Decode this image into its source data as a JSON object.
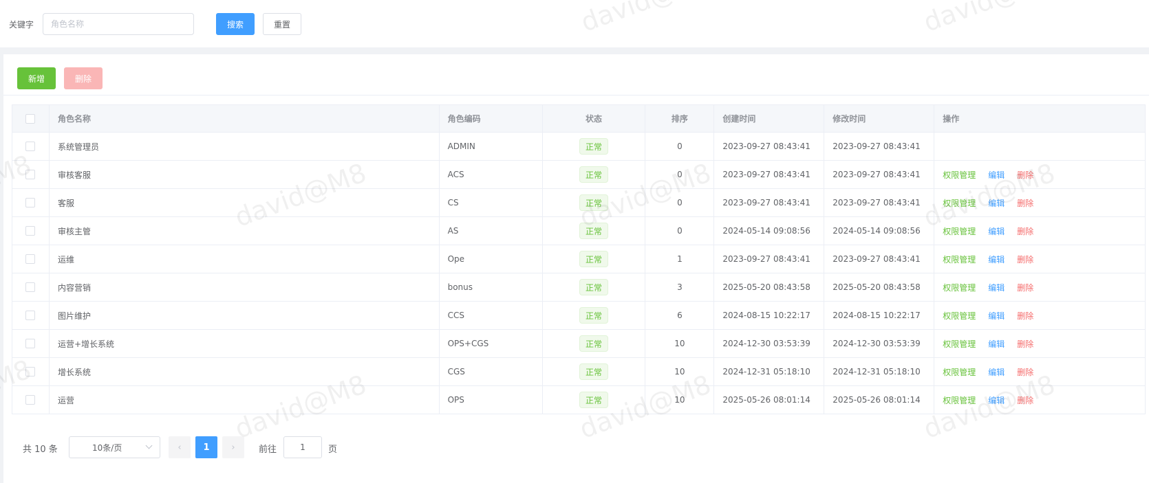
{
  "search": {
    "keyword_label": "关键字",
    "placeholder": "角色名称",
    "value": "",
    "search_label": "搜索",
    "reset_label": "重置"
  },
  "toolbar": {
    "add_label": "新增",
    "delete_label": "删除"
  },
  "table": {
    "headers": [
      "角色名称",
      "角色编码",
      "状态",
      "排序",
      "创建时间",
      "修改时间",
      "操作"
    ],
    "rows": [
      {
        "name": "系统管理员",
        "code": "ADMIN",
        "status": "正常",
        "sort": "0",
        "created": "2023-09-27 08:43:41",
        "modified": "2023-09-27 08:43:41",
        "actions": false
      },
      {
        "name": "审核客服",
        "code": "ACS",
        "status": "正常",
        "sort": "0",
        "created": "2023-09-27 08:43:41",
        "modified": "2023-09-27 08:43:41",
        "actions": true
      },
      {
        "name": "客服",
        "code": "CS",
        "status": "正常",
        "sort": "0",
        "created": "2023-09-27 08:43:41",
        "modified": "2023-09-27 08:43:41",
        "actions": true
      },
      {
        "name": "审核主管",
        "code": "AS",
        "status": "正常",
        "sort": "0",
        "created": "2024-05-14 09:08:56",
        "modified": "2024-05-14 09:08:56",
        "actions": true
      },
      {
        "name": "运维",
        "code": "Ope",
        "status": "正常",
        "sort": "1",
        "created": "2023-09-27 08:43:41",
        "modified": "2023-09-27 08:43:41",
        "actions": true
      },
      {
        "name": "内容营销",
        "code": "bonus",
        "status": "正常",
        "sort": "3",
        "created": "2025-05-20 08:43:58",
        "modified": "2025-05-20 08:43:58",
        "actions": true
      },
      {
        "name": "图片维护",
        "code": "CCS",
        "status": "正常",
        "sort": "6",
        "created": "2024-08-15 10:22:17",
        "modified": "2024-08-15 10:22:17",
        "actions": true
      },
      {
        "name": "运营+增长系统",
        "code": "OPS+CGS",
        "status": "正常",
        "sort": "10",
        "created": "2024-12-30 03:53:39",
        "modified": "2024-12-30 03:53:39",
        "actions": true
      },
      {
        "name": "增长系统",
        "code": "CGS",
        "status": "正常",
        "sort": "10",
        "created": "2024-12-31 05:18:10",
        "modified": "2024-12-31 05:18:10",
        "actions": true
      },
      {
        "name": "运营",
        "code": "OPS",
        "status": "正常",
        "sort": "10",
        "created": "2025-05-26 08:01:14",
        "modified": "2025-05-26 08:01:14",
        "actions": true
      }
    ],
    "action_labels": {
      "permission": "权限管理",
      "edit": "编辑",
      "delete": "删除"
    }
  },
  "pagination": {
    "total_text": "共 10 条",
    "page_size": "10条/页",
    "current_page": "1",
    "goto_label": "前往",
    "goto_value": "1",
    "goto_suffix": "页"
  },
  "watermark": "david@M8",
  "colors": {
    "primary": "#409eff",
    "success": "#67c23a",
    "danger": "#f56c6c",
    "danger_disabled": "#fab6b6"
  }
}
